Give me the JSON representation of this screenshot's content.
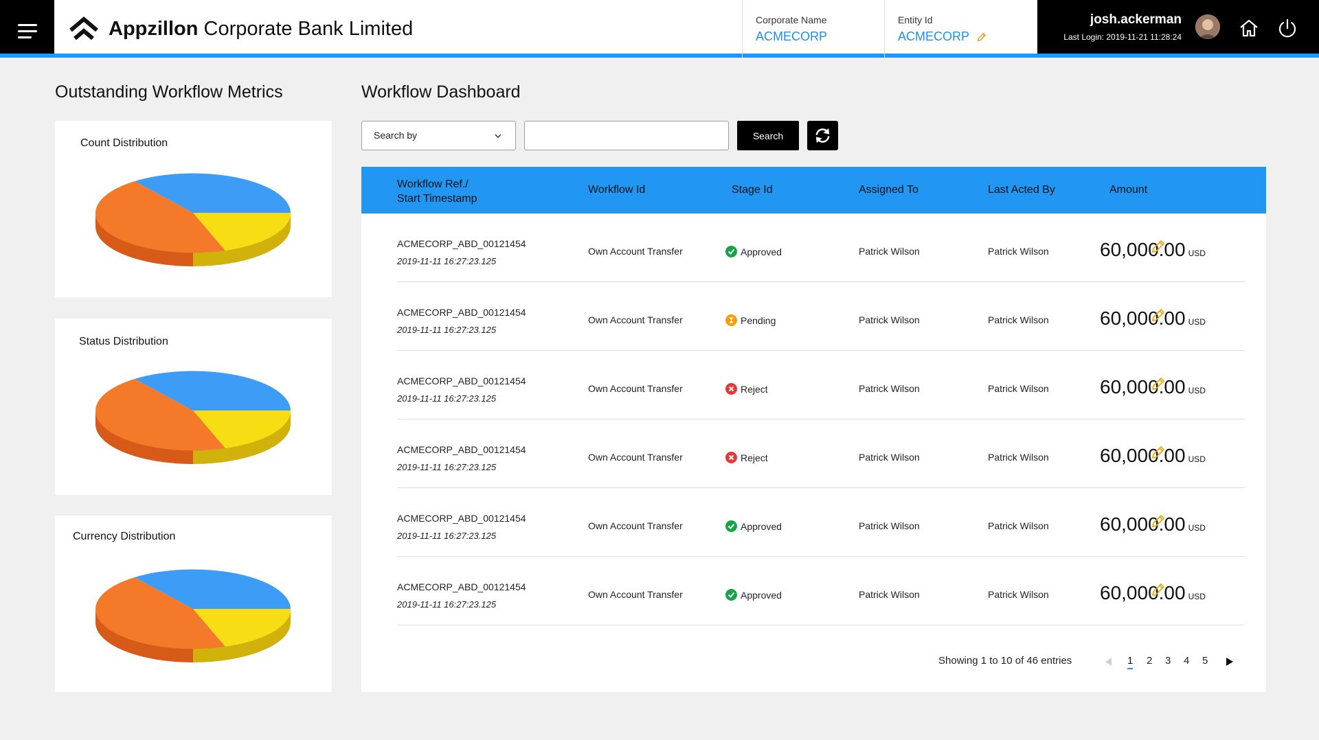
{
  "header": {
    "brand_bold": "Appzillon",
    "brand_rest": " Corporate Bank Limited",
    "corporate_name_label": "Corporate Name",
    "corporate_name_value": "ACMECORP",
    "entity_id_label": "Entity Id",
    "entity_id_value": "ACMECORP",
    "user_name": "josh.ackerman",
    "last_login": "Last Login: 2019-11-21 11:28:24",
    "icons": [
      "menu-icon",
      "brand-logo-icon",
      "pencil-icon",
      "avatar",
      "home-icon",
      "power-icon"
    ]
  },
  "metrics": {
    "title": "Outstanding Workflow Metrics",
    "cards": [
      {
        "title": "Count Distribution"
      },
      {
        "title": "Status Distribution"
      },
      {
        "title": "Currency Distribution"
      }
    ]
  },
  "dashboard": {
    "title": "Workflow Dashboard",
    "search_by": "Search by",
    "search_input_value": "",
    "search_button": "Search",
    "columns": {
      "ref_line1": "Workflow Ref./",
      "ref_line2": "Start Timestamp",
      "workflow_id": "Workflow Id",
      "stage_id": "Stage Id",
      "assigned_to": "Assigned To",
      "last_acted_by": "Last Acted By",
      "amount": "Amount"
    },
    "rows": [
      {
        "ref": "ACMECORP_ABD_00121454",
        "timestamp": "2019-11-11 16:27:23.125",
        "workflow_id": "Own Account Transfer",
        "stage": "Approved",
        "stage_icon": "check-icon",
        "assigned_to": "Patrick Wilson",
        "last_acted_by": "Patrick Wilson",
        "amount": "60,000.00",
        "currency": "USD"
      },
      {
        "ref": "ACMECORP_ABD_00121454",
        "timestamp": "2019-11-11 16:27:23.125",
        "workflow_id": "Own Account Transfer",
        "stage": "Pending",
        "stage_icon": "hourglass-icon",
        "assigned_to": "Patrick Wilson",
        "last_acted_by": "Patrick Wilson",
        "amount": "60,000.00",
        "currency": "USD"
      },
      {
        "ref": "ACMECORP_ABD_00121454",
        "timestamp": "2019-11-11 16:27:23.125",
        "workflow_id": "Own Account Transfer",
        "stage": "Reject",
        "stage_icon": "cross-icon",
        "assigned_to": "Patrick Wilson",
        "last_acted_by": "Patrick Wilson",
        "amount": "60,000.00",
        "currency": "USD"
      },
      {
        "ref": "ACMECORP_ABD_00121454",
        "timestamp": "2019-11-11 16:27:23.125",
        "workflow_id": "Own Account Transfer",
        "stage": "Reject",
        "stage_icon": "cross-icon",
        "assigned_to": "Patrick Wilson",
        "last_acted_by": "Patrick Wilson",
        "amount": "60,000.00",
        "currency": "USD"
      },
      {
        "ref": "ACMECORP_ABD_00121454",
        "timestamp": "2019-11-11 16:27:23.125",
        "workflow_id": "Own Account Transfer",
        "stage": "Approved",
        "stage_icon": "check-icon",
        "assigned_to": "Patrick Wilson",
        "last_acted_by": "Patrick Wilson",
        "amount": "60,000.00",
        "currency": "USD"
      },
      {
        "ref": "ACMECORP_ABD_00121454",
        "timestamp": "2019-11-11 16:27:23.125",
        "workflow_id": "Own Account Transfer",
        "stage": "Approved",
        "stage_icon": "check-icon",
        "assigned_to": "Patrick Wilson",
        "last_acted_by": "Patrick Wilson",
        "amount": "60,000.00",
        "currency": "USD"
      }
    ],
    "entries_text": "Showing 1 to 10 of 46 entries",
    "pages": [
      "1",
      "2",
      "3",
      "4",
      "5"
    ],
    "current_page": "1"
  },
  "colors": {
    "accent": "#2196f3",
    "link": "#1e8fe6",
    "approved": "#16a34a",
    "pending": "#f59e0b",
    "reject": "#e53935",
    "edit": "#e6a817",
    "pie_blue": "#3d9cf5",
    "pie_orange": "#f47a2a",
    "pie_yellow": "#f7dd13"
  }
}
